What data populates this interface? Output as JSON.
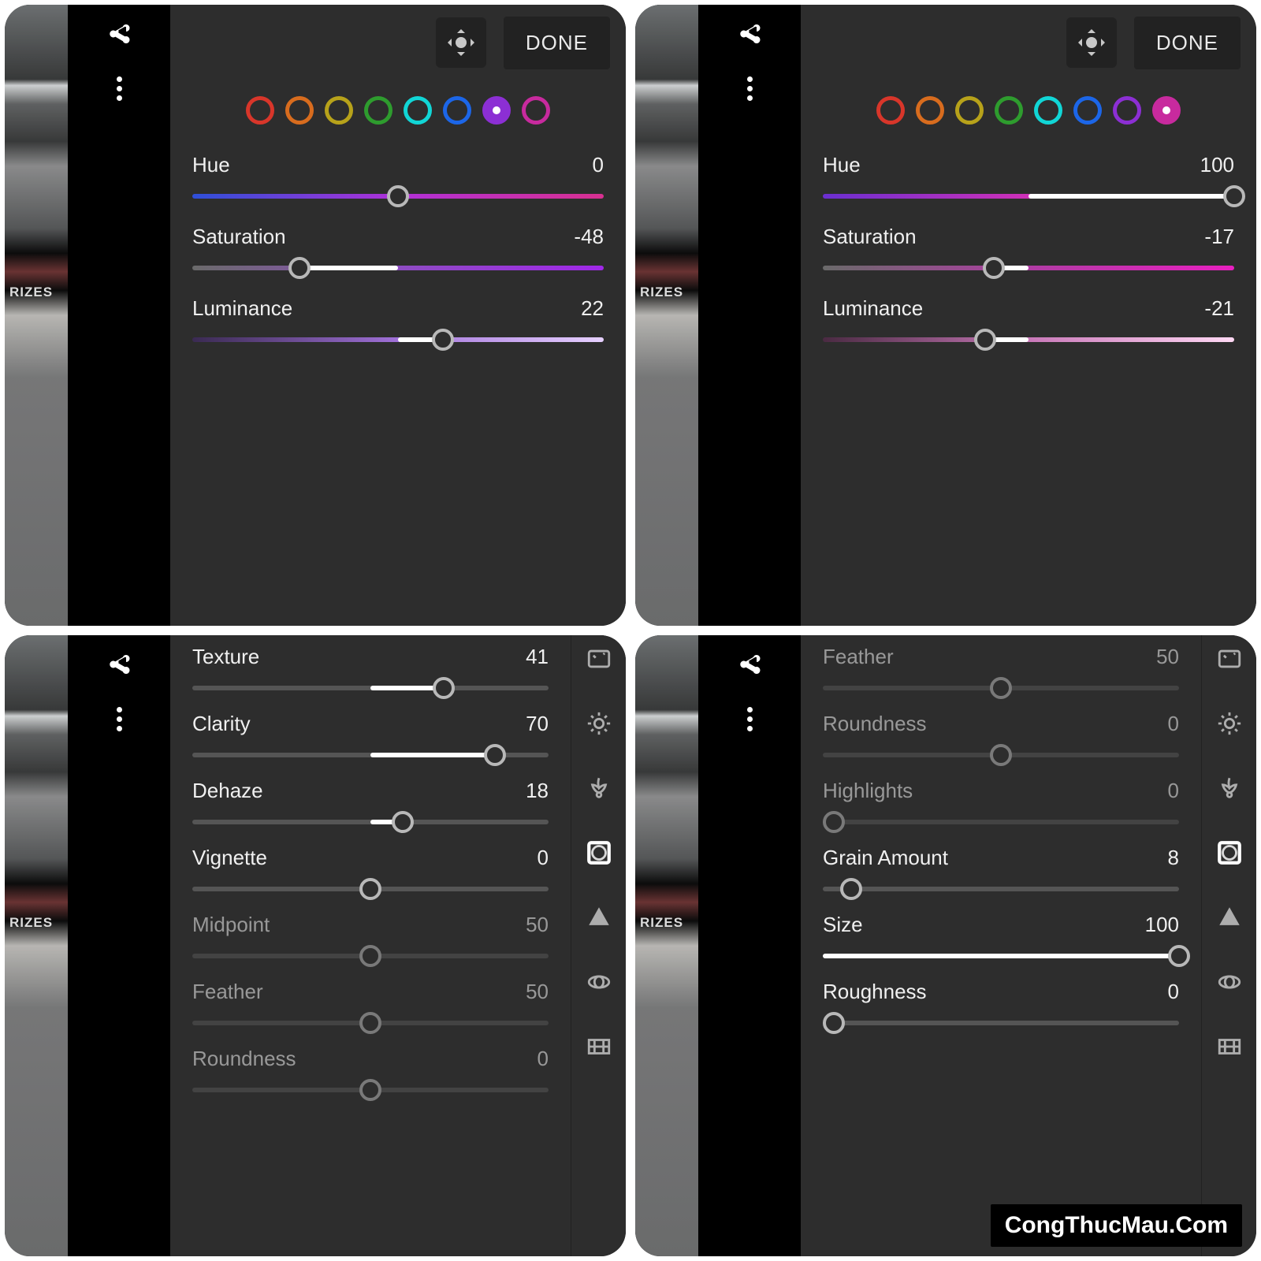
{
  "done_label": "DONE",
  "watermark": "CongThucMau.Com",
  "color_swatches": [
    {
      "name": "red",
      "color": "#d8362a"
    },
    {
      "name": "orange",
      "color": "#d86c1e"
    },
    {
      "name": "yellow",
      "color": "#b7a21a"
    },
    {
      "name": "green",
      "color": "#2e9c2e"
    },
    {
      "name": "aqua",
      "color": "#11d6d6"
    },
    {
      "name": "blue",
      "color": "#1c66e8"
    },
    {
      "name": "purple",
      "color": "#8c2fd4"
    },
    {
      "name": "magenta",
      "color": "#c82a9e"
    }
  ],
  "panels": {
    "tl": {
      "selected_swatch": 6,
      "sliders": [
        {
          "label": "Hue",
          "value": 0,
          "min": -100,
          "max": 100,
          "track_gradient": "linear-gradient(90deg,#2e4fd8,#b030d8,#d83090)"
        },
        {
          "label": "Saturation",
          "value": -48,
          "min": -100,
          "max": 100,
          "track_gradient": "linear-gradient(90deg,#6a6a6a,#8e4cc2,#a028e8)",
          "fill_to_center": true
        },
        {
          "label": "Luminance",
          "value": 22,
          "min": -100,
          "max": 100,
          "track_gradient": "linear-gradient(90deg,#3a2a52,#a070d8,#e6d0ff)",
          "fill_to_center": true
        }
      ]
    },
    "tr": {
      "selected_swatch": 7,
      "sliders": [
        {
          "label": "Hue",
          "value": 100,
          "min": -100,
          "max": 100,
          "track_gradient": "linear-gradient(90deg,#6a2fd0,#d030b8,#d83050)",
          "fill_to_center": true
        },
        {
          "label": "Saturation",
          "value": -17,
          "min": -100,
          "max": 100,
          "track_gradient": "linear-gradient(90deg,#6a6a6a,#b03ca4,#e820c0)",
          "fill_to_center": true
        },
        {
          "label": "Luminance",
          "value": -21,
          "min": -100,
          "max": 100,
          "track_gradient": "linear-gradient(90deg,#4a2a42,#c878b8,#ffd8f4)",
          "fill_to_center": true
        }
      ]
    },
    "bl": {
      "sliders": [
        {
          "label": "Texture",
          "value": 41,
          "min": -100,
          "max": 100,
          "fill_to_center": true
        },
        {
          "label": "Clarity",
          "value": 70,
          "min": -100,
          "max": 100,
          "fill_to_center": true
        },
        {
          "label": "Dehaze",
          "value": 18,
          "min": -100,
          "max": 100,
          "fill_to_center": true
        },
        {
          "label": "Vignette",
          "value": 0,
          "min": -100,
          "max": 100
        },
        {
          "label": "Midpoint",
          "value": 50,
          "min": 0,
          "max": 100,
          "dim": true
        },
        {
          "label": "Feather",
          "value": 50,
          "min": 0,
          "max": 100,
          "dim": true
        },
        {
          "label": "Roundness",
          "value": 0,
          "min": -100,
          "max": 100,
          "dim": true
        }
      ],
      "tools": [
        "auto",
        "light",
        "color",
        "effects-active",
        "detail",
        "optics",
        "geometry"
      ]
    },
    "br": {
      "sliders": [
        {
          "label": "Feather",
          "value": 50,
          "min": 0,
          "max": 100,
          "dim": true
        },
        {
          "label": "Roundness",
          "value": 0,
          "min": -100,
          "max": 100,
          "dim": true
        },
        {
          "label": "Highlights",
          "value": 0,
          "min": -100,
          "max": 100,
          "dim": true,
          "thumb_at_start": true
        },
        {
          "label": "Grain Amount",
          "value": 8,
          "min": 0,
          "max": 100,
          "thumb_from_zero": true
        },
        {
          "label": "Size",
          "value": 100,
          "min": 0,
          "max": 100,
          "thumb_from_zero": true,
          "full_fill": true
        },
        {
          "label": "Roughness",
          "value": 0,
          "min": -100,
          "max": 100,
          "thumb_at_start": true
        }
      ],
      "tools": [
        "auto",
        "light",
        "color",
        "effects-active",
        "detail",
        "optics",
        "geometry"
      ]
    }
  }
}
